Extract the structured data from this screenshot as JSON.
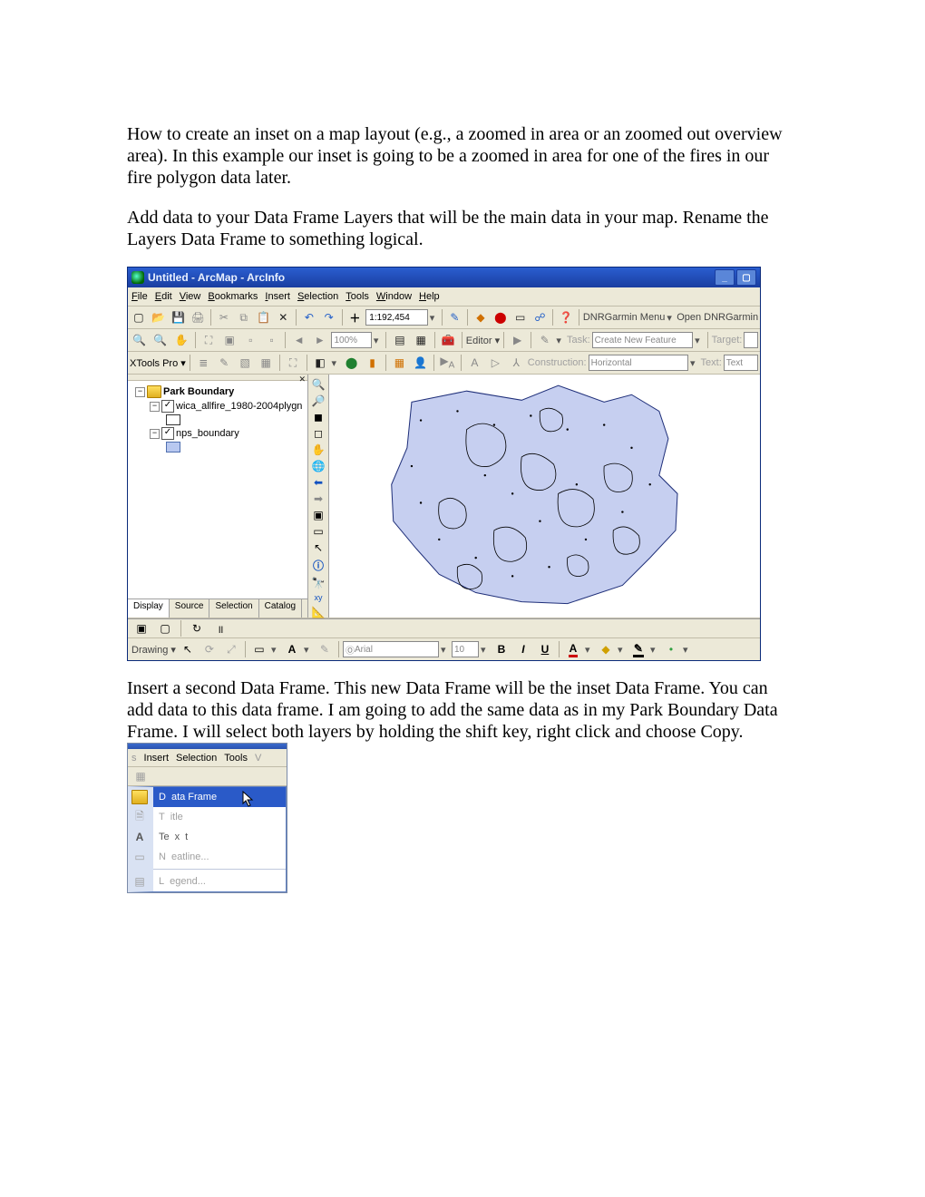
{
  "doc": {
    "para1": "How to create an inset on a map layout (e.g., a zoomed in area or an zoomed out overview area).  In this example our inset is going to be a zoomed in area for one of the fires in our fire polygon data later.",
    "para2": "Add data to your Data Frame Layers that will be the main data in your map.  Rename the Layers Data Frame to something logical.",
    "para3": "Insert a second Data Frame.  This new Data Frame will be the inset Data Frame.  You can add data to this data frame.  I am going to add the same data as in my Park Boundary Data Frame.  I will select both layers by holding the shift key, right click and choose Copy."
  },
  "arcmap": {
    "title": "Untitled - ArcMap - ArcInfo",
    "menus": [
      "File",
      "Edit",
      "View",
      "Bookmarks",
      "Insert",
      "Selection",
      "Tools",
      "Window",
      "Help"
    ],
    "scale": "1:192,454",
    "dnr_menu": "DNRGarmin Menu",
    "dnr_open": "Open DNRGarmin",
    "zoom_pct": "100%",
    "editor_label": "Editor",
    "task_label": "Task:",
    "task_value": "Create New Feature",
    "target_label": "Target:",
    "xtools_label": "XTools Pro",
    "construction_label": "Construction:",
    "construction_value": "Horizontal",
    "text_label": "Text:",
    "text_value": "Text",
    "toc": {
      "dataframe": "Park Boundary",
      "layers": [
        {
          "name": "wica_allfire_1980-2004plygn",
          "checked": true,
          "symbol": "outline"
        },
        {
          "name": "nps_boundary",
          "checked": true,
          "symbol": "blue"
        }
      ],
      "tabs": [
        "Display",
        "Source",
        "Selection",
        "Catalog"
      ]
    },
    "drawing_label": "Drawing",
    "font_name": "Arial",
    "font_size": "10"
  },
  "insert_menu": {
    "menubar": [
      "Insert",
      "Selection",
      "Tools"
    ],
    "items": [
      {
        "label": "Data Frame",
        "highlight": true,
        "icon": "df"
      },
      {
        "label": "Title",
        "disabled": true,
        "icon": "title"
      },
      {
        "label": "Text",
        "icon": "text"
      },
      {
        "label": "Neatline...",
        "disabled": true,
        "icon": "neat"
      },
      {
        "label": "Legend...",
        "disabled": true,
        "icon": "legend"
      }
    ]
  }
}
